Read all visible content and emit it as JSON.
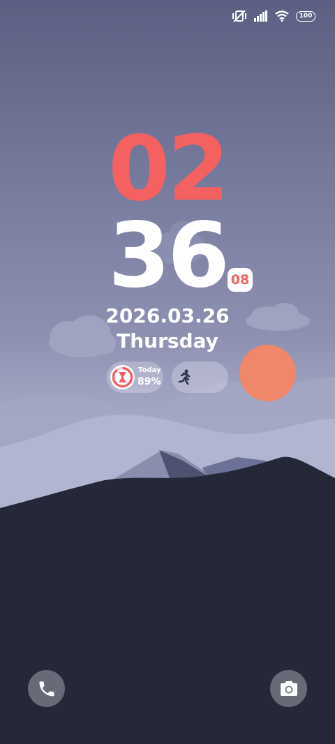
{
  "status_bar": {
    "icons": [
      "mute-vibrate-icon",
      "signal-icon",
      "wifi-icon"
    ],
    "battery_level": "100"
  },
  "clock": {
    "hour": "02",
    "minute": "36",
    "seconds": "08",
    "date": "2026.03.26",
    "weekday": "Thursday"
  },
  "widgets": {
    "activity": {
      "label": "Today",
      "value": "89%",
      "icon": "hourglass-ring-icon",
      "progress": 0.89
    },
    "steps": {
      "icon": "runner-icon"
    }
  },
  "shortcuts": {
    "left": "phone-icon",
    "right": "camera-icon"
  },
  "colors": {
    "accent": "#f46161",
    "sky_top": "#5b6083",
    "sky_bottom": "#c5c8dd",
    "ground": "#252838",
    "sun": "#f0866a"
  }
}
